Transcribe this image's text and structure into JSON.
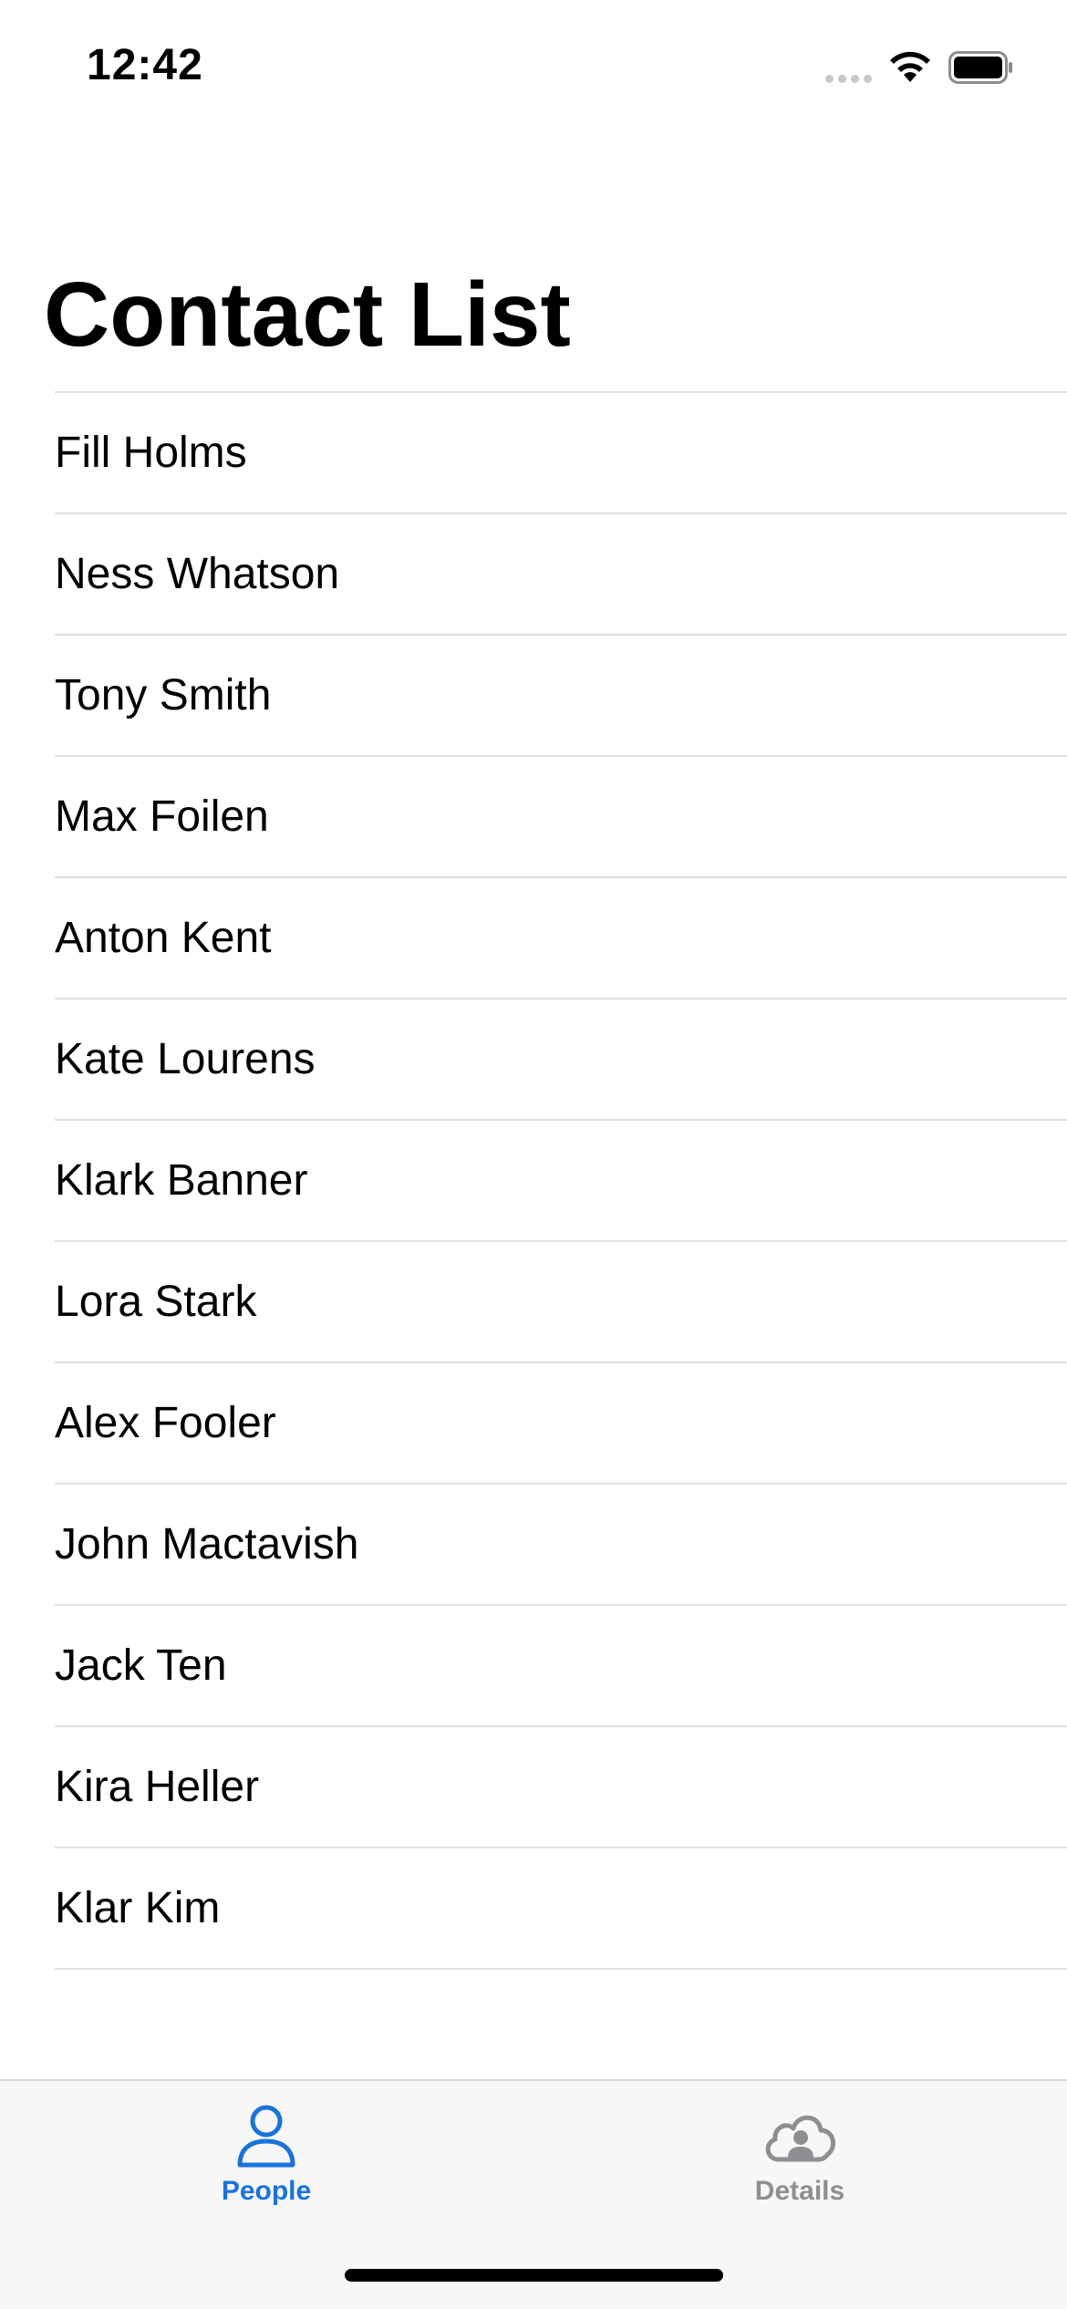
{
  "status_bar": {
    "time": "12:42",
    "icons": [
      "cellular-signal-icon",
      "wifi-icon",
      "battery-icon"
    ]
  },
  "page": {
    "title": "Contact List"
  },
  "contacts": [
    {
      "name": "Fill Holms"
    },
    {
      "name": "Ness Whatson"
    },
    {
      "name": "Tony Smith"
    },
    {
      "name": "Max Foilen"
    },
    {
      "name": "Anton Kent"
    },
    {
      "name": "Kate Lourens"
    },
    {
      "name": "Klark Banner"
    },
    {
      "name": "Lora Stark"
    },
    {
      "name": "Alex Fooler"
    },
    {
      "name": "John Mactavish"
    },
    {
      "name": "Jack Ten"
    },
    {
      "name": "Kira Heller"
    },
    {
      "name": "Klar Kim"
    }
  ],
  "tab_bar": {
    "tabs": [
      {
        "label": "People",
        "icon": "person-icon",
        "selected": true
      },
      {
        "label": "Details",
        "icon": "cloud-person-icon",
        "selected": false
      }
    ]
  },
  "colors": {
    "accent": "#1a73d9",
    "inactive_tab": "#8e8e93",
    "separator": "#e0e0e3",
    "tab_bar_background": "#f7f7f7"
  }
}
